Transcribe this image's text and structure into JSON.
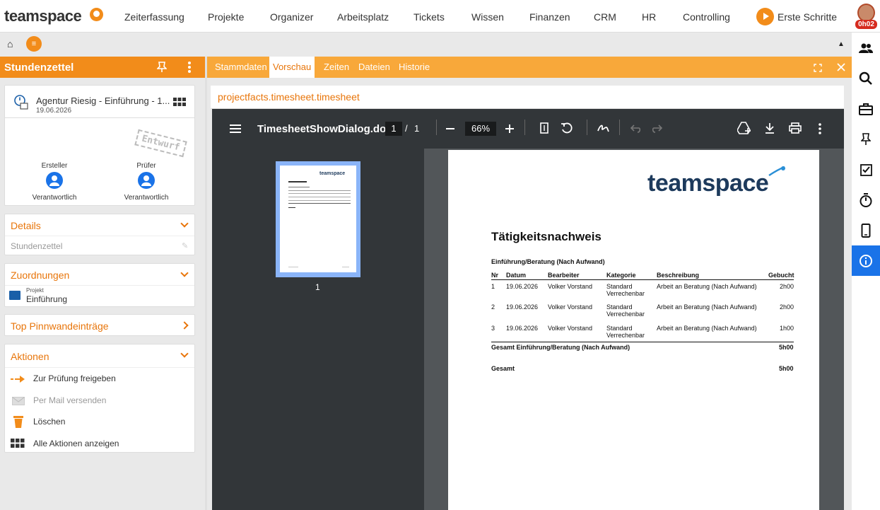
{
  "brand": {
    "logo_text": "teamspace"
  },
  "nav": {
    "items": [
      "Zeiterfassung",
      "Projekte",
      "Organizer",
      "Arbeitsplatz",
      "Tickets",
      "Wissen",
      "Finanzen",
      "CRM",
      "HR",
      "Controlling"
    ],
    "first_steps": "Erste Schritte",
    "timer": "0h02"
  },
  "left": {
    "header_title": "Stundenzettel",
    "record": {
      "title": "Agentur Riesig - Einführung - 1...",
      "date": "19.06.2026",
      "stamp": "Entwurf"
    },
    "roles": [
      {
        "label": "Ersteller",
        "value": "Verantwortlich"
      },
      {
        "label": "Prüfer",
        "value": "Verantwortlich"
      }
    ],
    "details": {
      "title": "Details",
      "type": "Stundenzettel"
    },
    "assignments": {
      "title": "Zuordnungen",
      "kind": "Projekt",
      "name": "Einführung"
    },
    "pinboard": {
      "title": "Top Pinnwandeinträge"
    },
    "actions": {
      "title": "Aktionen",
      "items": [
        "Zur Prüfung freigeben",
        "Per Mail versenden",
        "Löschen",
        "Alle Aktionen anzeigen"
      ]
    }
  },
  "tabs": [
    "Stammdaten",
    "Vorschau",
    "Zeiten",
    "Dateien",
    "Historie"
  ],
  "path": "projectfacts.timesheet.timesheet",
  "viewer": {
    "file_name": "TimesheetShowDialog.do",
    "page_current": "1",
    "page_sep": "/",
    "page_total": "1",
    "zoom": "66%",
    "thumb_label": "1"
  },
  "document": {
    "logo": "teamspace",
    "title": "Tätigkeitsnachweis",
    "section": "Einführung/Beratung (Nach Aufwand)",
    "columns": [
      "Nr",
      "Datum",
      "Bearbeiter",
      "Kategorie",
      "Beschreibung",
      "Gebucht"
    ],
    "rows": [
      {
        "nr": "1",
        "date": "19.06.2026",
        "user": "Volker Vorstand",
        "cat1": "Standard",
        "cat2": "Verrechenbar",
        "desc": "Arbeit an Beratung (Nach Aufwand)",
        "booked": "2h00"
      },
      {
        "nr": "2",
        "date": "19.06.2026",
        "user": "Volker Vorstand",
        "cat1": "Standard",
        "cat2": "Verrechenbar",
        "desc": "Arbeit an Beratung (Nach Aufwand)",
        "booked": "2h00"
      },
      {
        "nr": "3",
        "date": "19.06.2026",
        "user": "Volker Vorstand",
        "cat1": "Standard",
        "cat2": "Verrechenbar",
        "desc": "Arbeit an Beratung (Nach Aufwand)",
        "booked": "1h00"
      }
    ],
    "subtotal_label": "Gesamt Einführung/Beratung (Nach Aufwand)",
    "subtotal_value": "5h00",
    "total_label": "Gesamt",
    "total_value": "5h00"
  },
  "colors": {
    "accent": "#f28c1a",
    "accent_light": "#f8a83a",
    "active_blue": "#1a73e8",
    "viewer_dark": "#323639"
  }
}
